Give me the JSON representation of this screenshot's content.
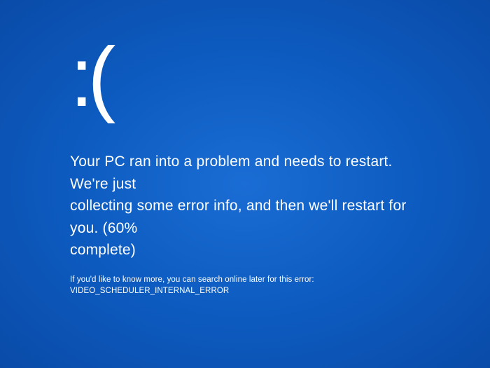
{
  "bsod": {
    "emoticon": ":(",
    "message_line1": "Your PC ran into a problem and needs to restart. We're just",
    "message_line2": "collecting some error info, and then we'll restart for you. (60%",
    "message_line3": "complete)",
    "progress_percent": 60,
    "help_text": "If you'd like to know more, you can search online later for this error: VIDEO_SCHEDULER_INTERNAL_ERROR",
    "error_code": "VIDEO_SCHEDULER_INTERNAL_ERROR"
  }
}
